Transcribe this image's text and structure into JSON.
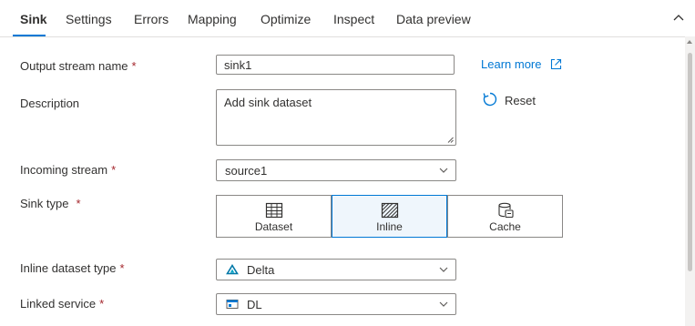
{
  "tabs": {
    "items": [
      {
        "label": "Sink"
      },
      {
        "label": "Settings"
      },
      {
        "label": "Errors"
      },
      {
        "label": "Mapping"
      },
      {
        "label": "Optimize"
      },
      {
        "label": "Inspect"
      },
      {
        "label": "Data preview"
      }
    ],
    "active_index": 0,
    "collapse_icon": "chevron-up-icon"
  },
  "form": {
    "output_stream": {
      "label": "Output stream name",
      "required": "*",
      "value": "sink1"
    },
    "description": {
      "label": "Description",
      "value": "Add sink dataset"
    },
    "incoming_stream": {
      "label": "Incoming stream",
      "required": "*",
      "value": "source1"
    },
    "sink_type": {
      "label": "Sink type",
      "required": "*",
      "options": [
        {
          "label": "Dataset",
          "icon": "table-icon"
        },
        {
          "label": "Inline",
          "icon": "inline-hatched-icon"
        },
        {
          "label": "Cache",
          "icon": "cache-icon"
        }
      ],
      "selected": "Inline"
    },
    "inline_dataset_type": {
      "label": "Inline dataset type",
      "required": "*",
      "value": "Delta",
      "icon": "delta-icon"
    },
    "linked_service": {
      "label": "Linked service",
      "required": "*",
      "value": "DL",
      "icon": "storage-icon"
    }
  },
  "actions": {
    "learn_more": "Learn more",
    "reset": "Reset"
  },
  "colors": {
    "accent": "#0078d4",
    "required": "#a4262c",
    "border": "#8a8886",
    "selected_bg": "#eff6fc"
  }
}
